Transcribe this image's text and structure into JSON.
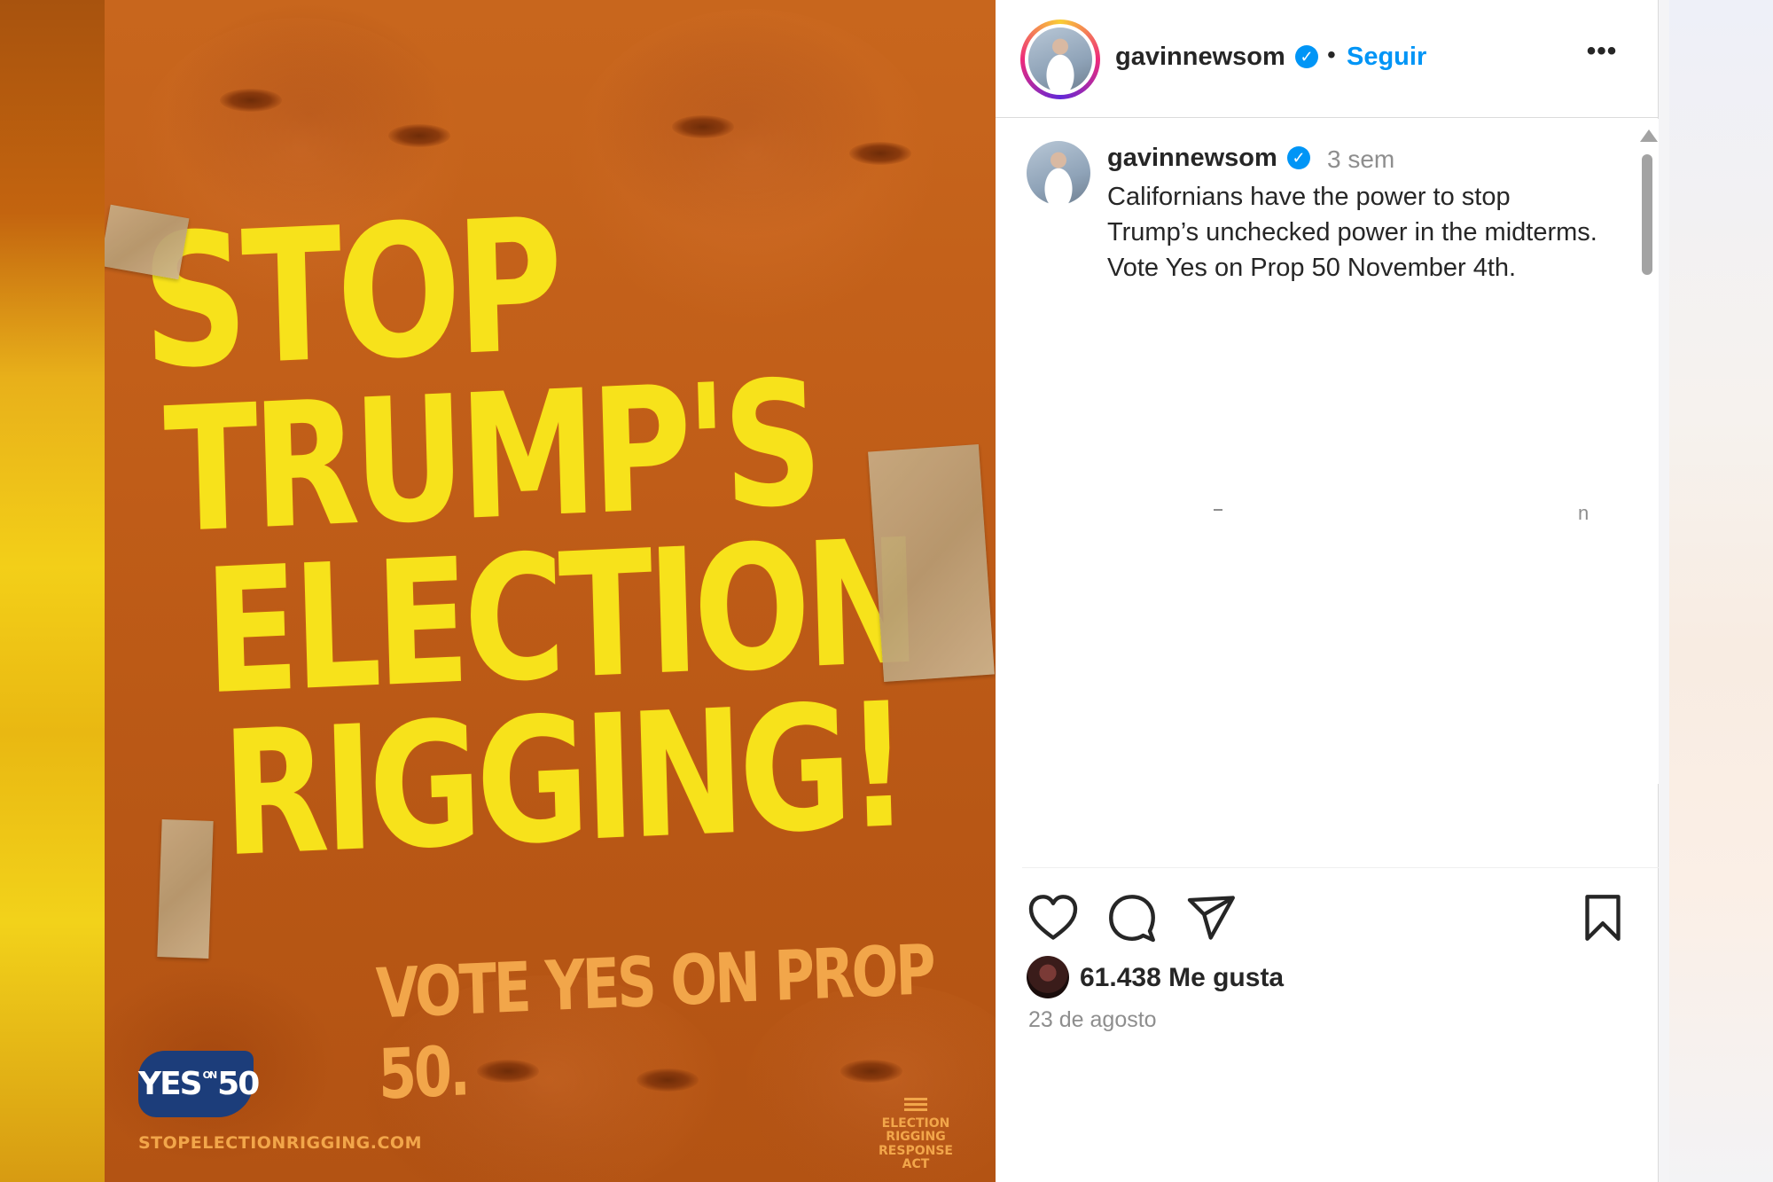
{
  "post": {
    "headline_lines": [
      "STOP",
      "TRUMP'S",
      "ELECTION",
      "RIGGING!"
    ],
    "subline": "VOTE YES ON PROP 50.",
    "yes_logo": {
      "yes": "YES",
      "on": "ON",
      "number": "50"
    },
    "website": "STOPELECTIONRIGGING.COM",
    "act_logo_lines": [
      "ELECTION RIGGING",
      "RESPONSE ACT"
    ]
  },
  "header": {
    "username": "gavinnewsom",
    "separator": "•",
    "follow_label": "Seguir",
    "more_label": "•••"
  },
  "caption": {
    "username": "gavinnewsom",
    "time_ago": "3 sem",
    "text": "Californians have the power to stop Trump’s unchecked power in the midterms. Vote Yes on Prop 50 November 4th.",
    "stray_char": "n"
  },
  "engagement": {
    "likes_text": "61.438 Me gusta",
    "date": "23 de agosto"
  },
  "icons": {
    "verified": "verified-badge-icon",
    "like": "heart-icon",
    "comment": "comment-bubble-icon",
    "share": "paper-plane-icon",
    "save": "bookmark-icon"
  },
  "colors": {
    "accent_blue": "#0095f6",
    "headline_yellow": "#f7e21b",
    "poster_orange": "#c05d18"
  }
}
